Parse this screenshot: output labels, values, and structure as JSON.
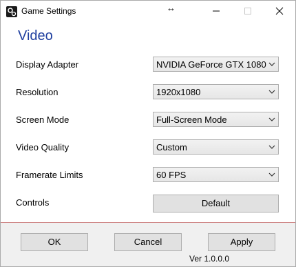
{
  "window": {
    "title": "Game Settings",
    "controls": {
      "minimize": "minimize-icon",
      "maximize": "maximize-icon",
      "close": "close-icon"
    }
  },
  "section": {
    "title": "Video"
  },
  "settings": [
    {
      "label": "Display Adapter",
      "value": "NVIDIA GeForce GTX 1080"
    },
    {
      "label": "Resolution",
      "value": "1920x1080"
    },
    {
      "label": "Screen Mode",
      "value": "Full-Screen Mode"
    },
    {
      "label": "Video Quality",
      "value": "Custom"
    },
    {
      "label": "Framerate Limits",
      "value": "60 FPS"
    }
  ],
  "controls_row": {
    "label": "Controls",
    "button": "Default"
  },
  "footer": {
    "ok": "OK",
    "cancel": "Cancel",
    "apply": "Apply",
    "version": "Ver  1.0.0.0"
  },
  "colors": {
    "section_title": "#1f3f9f",
    "footer_bg": "#f0f0f0",
    "button_bg": "#e1e1e1"
  }
}
